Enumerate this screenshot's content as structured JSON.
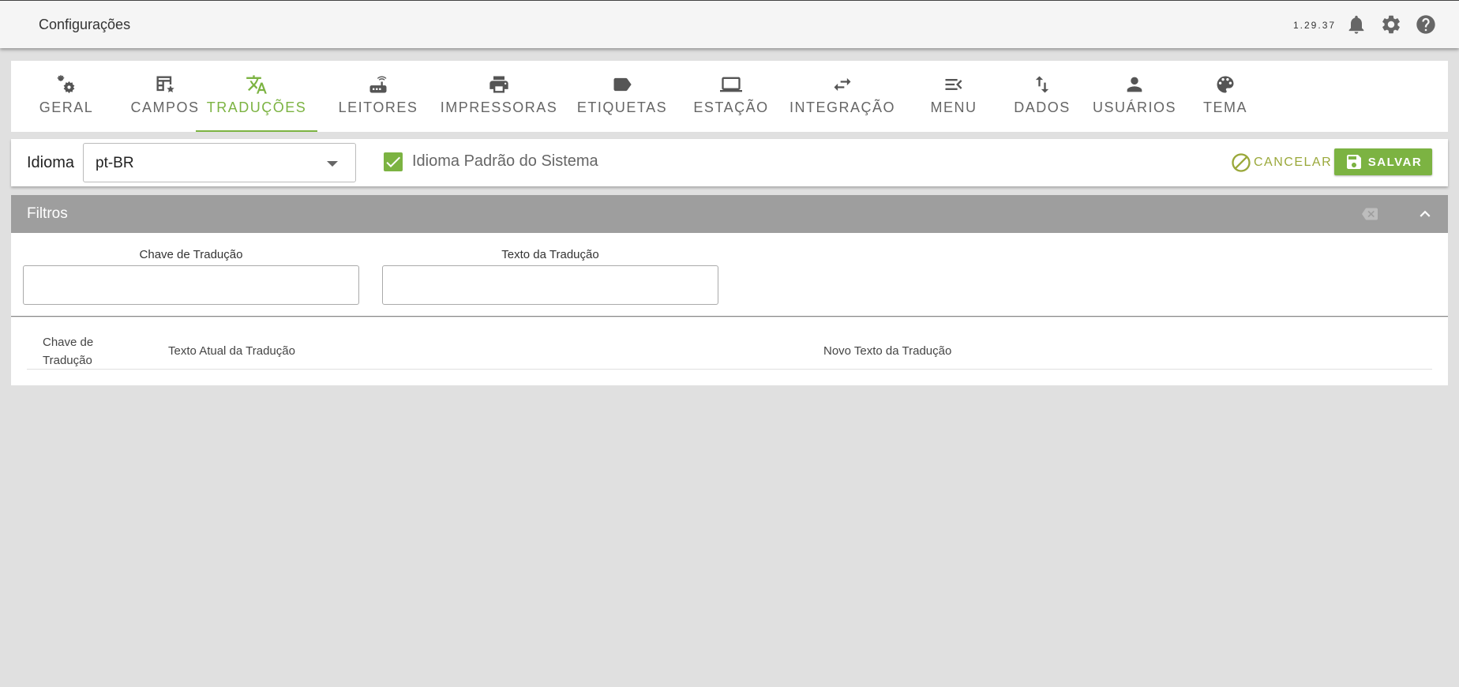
{
  "header": {
    "title": "Configurações",
    "version": "1.29.37",
    "icons": [
      "bell-icon",
      "gear-icon",
      "help-icon"
    ]
  },
  "tabs": [
    {
      "label": "GERAL",
      "icon": "settings-gears-icon",
      "active": false
    },
    {
      "label": "CAMPOS",
      "icon": "table-star-icon",
      "active": false
    },
    {
      "label": "TRADUÇÕES",
      "icon": "translate-icon",
      "active": true
    },
    {
      "label": "LEITORES",
      "icon": "router-icon",
      "active": false
    },
    {
      "label": "IMPRESSORAS",
      "icon": "printer-icon",
      "active": false
    },
    {
      "label": "ETIQUETAS",
      "icon": "label-icon",
      "active": false
    },
    {
      "label": "ESTAÇÃO",
      "icon": "laptop-icon",
      "active": false
    },
    {
      "label": "INTEGRAÇÃO",
      "icon": "swap-arrows-icon",
      "active": false
    },
    {
      "label": "MENU",
      "icon": "menu-open-icon",
      "active": false
    },
    {
      "label": "DADOS",
      "icon": "import-export-icon",
      "active": false
    },
    {
      "label": "USUÁRIOS",
      "icon": "person-icon",
      "active": false
    },
    {
      "label": "TEMA",
      "icon": "palette-icon",
      "active": false
    }
  ],
  "language_bar": {
    "label": "Idioma",
    "selected_language": "pt-BR",
    "default_checkbox_label": "Idioma Padrão do Sistema",
    "default_checked": true,
    "cancel_label": "CANCELAR",
    "save_label": "SALVAR"
  },
  "filters": {
    "title": "Filtros",
    "fields": [
      {
        "label": "Chave de Tradução",
        "value": ""
      },
      {
        "label": "Texto da Tradução",
        "value": ""
      }
    ]
  },
  "table": {
    "columns": [
      "Chave de Tradução",
      "Texto Atual da Tradução",
      "Novo Texto da Tradução"
    ],
    "rows": []
  },
  "colors": {
    "accent": "#7cb342",
    "cancel": "#9aa83a",
    "filters_header": "#9e9e9e",
    "background": "#e0e0e0"
  }
}
